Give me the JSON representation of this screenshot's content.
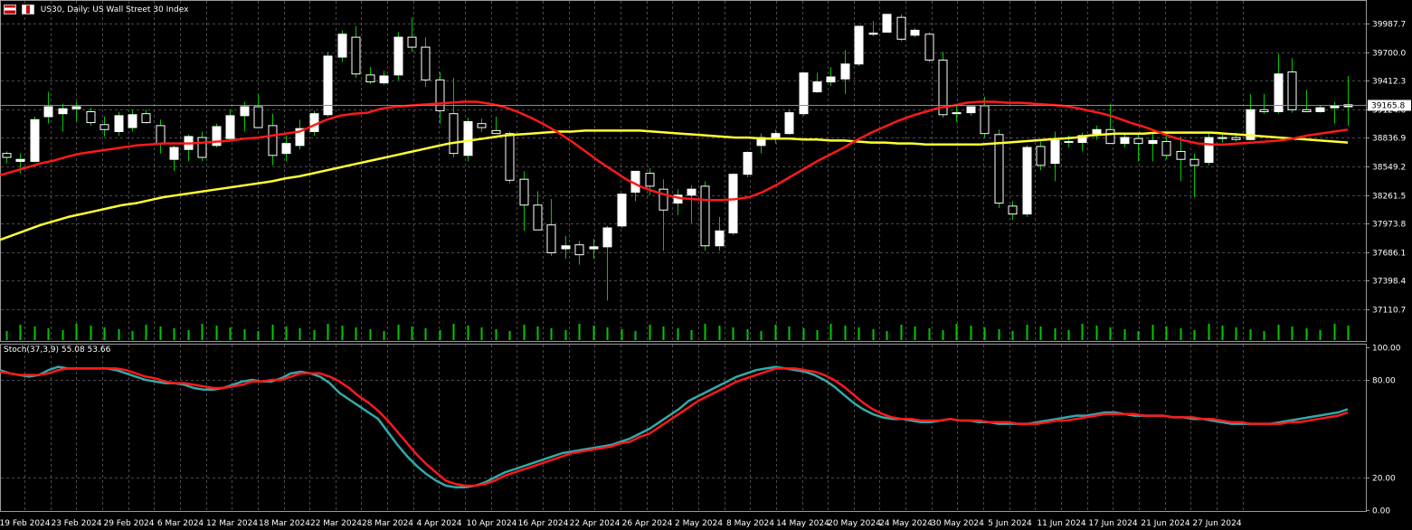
{
  "header": {
    "symbol_line": "US30, Daily:  US Wall Street 30 Index",
    "indicator_line": "Stoch(37,3,9) 55.08 53.66"
  },
  "icons": {
    "flag": "flag-icon",
    "chart_type": "candlestick-icon"
  },
  "colors": {
    "background": "#000000",
    "grid": "#4a4a4a",
    "bull_candle": "#ffffff",
    "bear_candle": "#000000",
    "wick": "#00c800",
    "ma_fast": "#ff1a1a",
    "ma_slow": "#ffff33",
    "stoch_main": "#33aaaa",
    "stoch_signal": "#ff1a1a",
    "volume": "#00c800",
    "price_marker_bg": "#ffffff",
    "price_marker_text": "#000000"
  },
  "chart_data": [
    {
      "type": "candlestick",
      "title": "US30, Daily:  US Wall Street 30 Index",
      "ylim": [
        37000,
        40150
      ],
      "price_ticks": [
        "39987.7",
        "39700.0",
        "39412.3",
        "39124.6",
        "38836.9",
        "38549.2",
        "38261.5",
        "37973.8",
        "37686.1",
        "37398.4",
        "37110.7"
      ],
      "current_price_label": "39165.8",
      "current_price": 39165.8,
      "date_ticks": [
        "19 Feb 2024",
        "23 Feb 2024",
        "29 Feb 2024",
        "6 Mar 2024",
        "12 Mar 2024",
        "18 Mar 2024",
        "22 Mar 2024",
        "28 Mar 2024",
        "4 Apr 2024",
        "10 Apr 2024",
        "16 Apr 2024",
        "22 Apr 2024",
        "26 Apr 2024",
        "2 May 2024",
        "8 May 2024",
        "14 May 2024",
        "20 May 2024",
        "24 May 2024",
        "30 May 2024",
        "5 Jun 2024",
        "11 Jun 2024",
        "17 Jun 2024",
        "21 Jun 2024",
        "27 Jun 2024"
      ],
      "ohlc": [
        [
          38680,
          38700,
          38580,
          38640
        ],
        [
          38600,
          38680,
          38480,
          38620
        ],
        [
          38600,
          39050,
          38590,
          39020
        ],
        [
          39050,
          39300,
          38980,
          39150
        ],
        [
          39080,
          39180,
          38900,
          39130
        ],
        [
          39130,
          39200,
          39000,
          39150
        ],
        [
          39100,
          39140,
          38960,
          38990
        ],
        [
          38970,
          39050,
          38850,
          38920
        ],
        [
          38900,
          39100,
          38860,
          39060
        ],
        [
          38940,
          39120,
          38900,
          39070
        ],
        [
          39080,
          39120,
          38980,
          38990
        ],
        [
          38960,
          39020,
          38680,
          38780
        ],
        [
          38620,
          38760,
          38500,
          38740
        ],
        [
          38720,
          38870,
          38600,
          38850
        ],
        [
          38840,
          38900,
          38600,
          38640
        ],
        [
          38760,
          38980,
          38740,
          38950
        ],
        [
          38830,
          39120,
          38800,
          39060
        ],
        [
          39060,
          39200,
          38900,
          39150
        ],
        [
          39150,
          39280,
          38980,
          38940
        ],
        [
          38960,
          39080,
          38560,
          38660
        ],
        [
          38680,
          38860,
          38600,
          38780
        ],
        [
          38760,
          39020,
          38720,
          38930
        ],
        [
          38900,
          39110,
          38860,
          39080
        ],
        [
          39070,
          39700,
          39050,
          39660
        ],
        [
          39650,
          39920,
          39600,
          39880
        ],
        [
          39850,
          39960,
          39440,
          39480
        ],
        [
          39470,
          39550,
          39380,
          39400
        ],
        [
          39390,
          39510,
          39370,
          39460
        ],
        [
          39470,
          39900,
          39420,
          39850
        ],
        [
          39850,
          40050,
          39700,
          39750
        ],
        [
          39750,
          39850,
          39350,
          39420
        ],
        [
          39420,
          39500,
          38980,
          39110
        ],
        [
          39080,
          39440,
          38640,
          38680
        ],
        [
          38660,
          39040,
          38600,
          39000
        ],
        [
          38980,
          39030,
          38900,
          38940
        ],
        [
          38910,
          39050,
          38880,
          38880
        ],
        [
          38880,
          38900,
          38380,
          38410
        ],
        [
          38420,
          38500,
          37900,
          38160
        ],
        [
          38160,
          38300,
          37920,
          37910
        ],
        [
          37960,
          38220,
          37650,
          37680
        ],
        [
          37720,
          37850,
          37620,
          37750
        ],
        [
          37760,
          37800,
          37560,
          37660
        ],
        [
          37720,
          37820,
          37620,
          37740
        ],
        [
          37740,
          37950,
          37200,
          37930
        ],
        [
          37950,
          38280,
          37930,
          38270
        ],
        [
          38290,
          38500,
          38200,
          38500
        ],
        [
          38480,
          38530,
          38260,
          38350
        ],
        [
          38320,
          38420,
          37700,
          38110
        ],
        [
          38180,
          38320,
          38060,
          38260
        ],
        [
          38260,
          38360,
          37980,
          38320
        ],
        [
          38350,
          38400,
          37700,
          37750
        ],
        [
          37750,
          38040,
          37700,
          37900
        ],
        [
          37880,
          38480,
          37860,
          38470
        ],
        [
          38470,
          38700,
          38440,
          38690
        ],
        [
          38760,
          38880,
          38680,
          38840
        ],
        [
          38840,
          38920,
          38780,
          38880
        ],
        [
          38880,
          39120,
          38870,
          39090
        ],
        [
          39080,
          39500,
          39060,
          39490
        ],
        [
          39300,
          39490,
          39290,
          39400
        ],
        [
          39400,
          39550,
          39360,
          39450
        ],
        [
          39430,
          39720,
          39280,
          39580
        ],
        [
          39580,
          39960,
          39560,
          39960
        ],
        [
          39880,
          40010,
          39860,
          39890
        ],
        [
          39900,
          40080,
          39900,
          40080
        ],
        [
          40050,
          40080,
          39810,
          39830
        ],
        [
          39870,
          39940,
          39850,
          39920
        ],
        [
          39880,
          39900,
          39600,
          39620
        ],
        [
          39620,
          39700,
          39040,
          39070
        ],
        [
          39080,
          39160,
          39000,
          39090
        ],
        [
          39090,
          39140,
          39060,
          39150
        ],
        [
          39160,
          39250,
          38840,
          38880
        ],
        [
          38870,
          38920,
          38130,
          38180
        ],
        [
          38150,
          38200,
          38010,
          38070
        ],
        [
          38070,
          38760,
          38040,
          38740
        ],
        [
          38750,
          38800,
          38510,
          38560
        ],
        [
          38580,
          38900,
          38400,
          38810
        ],
        [
          38800,
          38860,
          38740,
          38790
        ],
        [
          38790,
          38890,
          38700,
          38860
        ],
        [
          38880,
          38960,
          38820,
          38920
        ],
        [
          38920,
          39180,
          38800,
          38780
        ],
        [
          38780,
          38880,
          38740,
          38840
        ],
        [
          38830,
          38880,
          38600,
          38780
        ],
        [
          38780,
          38880,
          38600,
          38810
        ],
        [
          38800,
          38880,
          38620,
          38660
        ],
        [
          38700,
          38850,
          38400,
          38620
        ],
        [
          38620,
          38680,
          38240,
          38560
        ],
        [
          38590,
          38880,
          38560,
          38840
        ],
        [
          38840,
          38880,
          38790,
          38830
        ],
        [
          38840,
          38890,
          38800,
          38820
        ],
        [
          38820,
          39280,
          38810,
          39120
        ],
        [
          39120,
          39280,
          39080,
          39100
        ],
        [
          39100,
          39680,
          39080,
          39480
        ],
        [
          39500,
          39640,
          39090,
          39120
        ],
        [
          39120,
          39320,
          39100,
          39100
        ],
        [
          39100,
          39160,
          39090,
          39140
        ],
        [
          39140,
          39200,
          38980,
          39160
        ],
        [
          39150,
          39460,
          38960,
          39170
        ]
      ],
      "ma_fast": [
        38460,
        38500,
        38540,
        38580,
        38610,
        38650,
        38680,
        38700,
        38720,
        38740,
        38760,
        38770,
        38780,
        38780,
        38780,
        38790,
        38800,
        38810,
        38830,
        38840,
        38860,
        38880,
        38900,
        38960,
        39020,
        39060,
        39080,
        39090,
        39130,
        39150,
        39160,
        39170,
        39180,
        39190,
        39200,
        39200,
        39180,
        39150,
        39100,
        39040,
        38970,
        38890,
        38800,
        38700,
        38600,
        38510,
        38420,
        38350,
        38300,
        38260,
        38230,
        38220,
        38210,
        38210,
        38220,
        38240,
        38290,
        38360,
        38440,
        38520,
        38600,
        38670,
        38740,
        38820,
        38890,
        38950,
        39010,
        39060,
        39100,
        39140,
        39160,
        39190,
        39200,
        39200,
        39190,
        39190,
        39180,
        39170,
        39160,
        39140,
        39110,
        39080,
        39040,
        38990,
        38950,
        38900,
        38850,
        38810,
        38780,
        38770,
        38770,
        38780,
        38790,
        38800,
        38810,
        38830,
        38860,
        38880,
        38900,
        38920
      ],
      "ma_slow": [
        37810,
        37860,
        37910,
        37960,
        38000,
        38040,
        38070,
        38100,
        38130,
        38160,
        38180,
        38210,
        38240,
        38260,
        38280,
        38300,
        38320,
        38340,
        38360,
        38380,
        38400,
        38430,
        38450,
        38480,
        38510,
        38540,
        38570,
        38600,
        38630,
        38660,
        38690,
        38720,
        38750,
        38780,
        38800,
        38820,
        38840,
        38860,
        38870,
        38880,
        38890,
        38900,
        38900,
        38910,
        38910,
        38910,
        38910,
        38910,
        38900,
        38890,
        38880,
        38870,
        38860,
        38850,
        38840,
        38840,
        38830,
        38830,
        38830,
        38820,
        38820,
        38810,
        38810,
        38800,
        38790,
        38790,
        38780,
        38780,
        38770,
        38770,
        38770,
        38770,
        38770,
        38780,
        38790,
        38800,
        38810,
        38820,
        38830,
        38840,
        38860,
        38870,
        38880,
        38880,
        38880,
        38890,
        38890,
        38890,
        38890,
        38890,
        38880,
        38870,
        38860,
        38850,
        38840,
        38830,
        38820,
        38810,
        38800,
        38790
      ],
      "volume": [
        5,
        5,
        5,
        5,
        5,
        5,
        5,
        5,
        5,
        5,
        5,
        5,
        5,
        5,
        5,
        5,
        5,
        5,
        5,
        5,
        5,
        5,
        5,
        5,
        5,
        5,
        5,
        5,
        5,
        5,
        5,
        5,
        5,
        5,
        5,
        5,
        5,
        5,
        5,
        5,
        5,
        5,
        5,
        5,
        5,
        5,
        5,
        5,
        5,
        5,
        5,
        5,
        5,
        5,
        5,
        5,
        5,
        5,
        5,
        5,
        5,
        5,
        5,
        5,
        5,
        5,
        5,
        5,
        5,
        5,
        5,
        5,
        5,
        5,
        5,
        5,
        5,
        5,
        5,
        5,
        5,
        5,
        5,
        5,
        5,
        5,
        5,
        5,
        5,
        5,
        5,
        5,
        5,
        5,
        5,
        5,
        5,
        5,
        5,
        5
      ]
    },
    {
      "type": "line",
      "title": "Stoch(37,3,9) 55.08 53.66",
      "ylim": [
        0,
        100
      ],
      "y_ticks": [
        "100.00",
        "80.00",
        "20.00",
        "0.00"
      ],
      "series": [
        {
          "values": [
            86,
            84,
            83,
            82,
            83,
            86,
            88,
            87,
            87,
            87,
            87,
            87,
            86,
            84,
            82,
            80,
            79,
            78,
            78,
            77,
            75,
            74,
            74,
            75,
            77,
            79,
            80,
            79,
            79,
            81,
            84,
            85,
            84,
            82,
            78,
            72,
            68,
            64,
            60,
            56,
            48,
            40,
            33,
            27,
            22,
            18,
            15,
            14,
            14,
            15,
            17,
            20,
            23,
            25,
            27,
            29,
            31,
            33,
            35,
            36,
            37,
            38,
            39,
            40,
            42,
            44,
            47,
            50,
            54,
            58,
            62,
            67,
            70,
            73,
            76,
            79,
            82,
            84,
            86,
            87,
            88,
            87,
            86,
            85,
            83,
            80,
            76,
            71,
            66,
            62,
            59,
            57,
            56,
            56,
            55,
            54,
            54,
            55,
            56,
            55,
            55,
            54,
            54,
            53,
            53,
            53,
            53,
            54,
            55,
            56,
            57,
            58,
            58,
            59,
            60,
            60,
            59,
            58,
            58,
            58,
            58,
            57,
            57,
            56,
            56,
            55,
            54,
            53,
            53,
            53,
            53,
            53,
            54,
            55,
            56,
            57,
            58,
            59,
            60,
            62
          ]
        },
        {
          "values": [
            85,
            84,
            83,
            83,
            83,
            84,
            86,
            87,
            87,
            87,
            87,
            87,
            87,
            86,
            84,
            82,
            81,
            79,
            78,
            78,
            77,
            76,
            75,
            75,
            76,
            77,
            79,
            79,
            80,
            80,
            82,
            84,
            84,
            84,
            82,
            79,
            75,
            70,
            66,
            61,
            55,
            48,
            41,
            34,
            28,
            23,
            18,
            16,
            15,
            15,
            16,
            18,
            21,
            23,
            25,
            27,
            29,
            31,
            33,
            35,
            36,
            37,
            38,
            39,
            41,
            42,
            45,
            47,
            51,
            55,
            59,
            63,
            67,
            70,
            73,
            76,
            79,
            81,
            83,
            85,
            87,
            87,
            87,
            86,
            85,
            83,
            80,
            76,
            71,
            66,
            62,
            59,
            57,
            56,
            56,
            55,
            55,
            55,
            56,
            55,
            55,
            55,
            54,
            54,
            54,
            53,
            53,
            53,
            54,
            55,
            55,
            56,
            57,
            58,
            59,
            59,
            59,
            59,
            58,
            58,
            58,
            57,
            57,
            57,
            56,
            56,
            55,
            54,
            54,
            53,
            53,
            53,
            53,
            54,
            54,
            55,
            56,
            57,
            58,
            60
          ]
        }
      ]
    }
  ]
}
